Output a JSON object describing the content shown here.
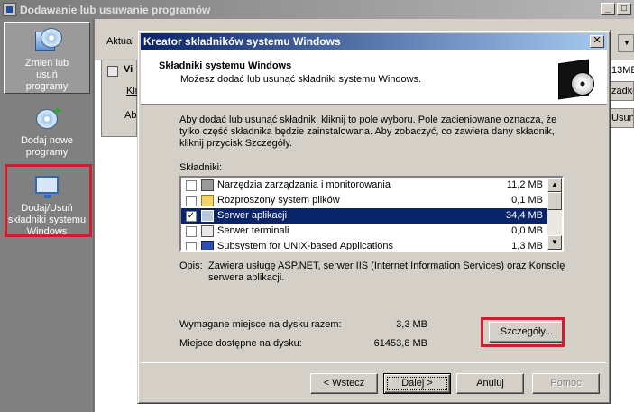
{
  "parent": {
    "title": "Dodawanie lub usuwanie programów",
    "sidebar": {
      "items": [
        {
          "label": "Zmień lub usuń programy",
          "icon": "cd-box-icon"
        },
        {
          "label": "Dodaj nowe programy",
          "icon": "cd-add-icon"
        },
        {
          "label": "Dodaj/Usuń składniki systemu Windows",
          "icon": "windows-components-icon"
        }
      ]
    },
    "main": {
      "sort_label": "Aktual",
      "item_title": "Vi",
      "item_link": "Kli",
      "item_sub": "Ab",
      "size": "13MB",
      "right_button_1": "zadko",
      "right_button_2": "Usuń"
    }
  },
  "dialog": {
    "title": "Kreator składników systemu Windows",
    "header_title": "Składniki systemu Windows",
    "header_subtitle": "Możesz dodać lub usunąć składniki systemu Windows.",
    "intro": "Aby dodać lub usunąć składnik, kliknij to pole wyboru. Pole zacieniowane oznacza, że tylko część składnika będzie zainstalowana. Aby zobaczyć, co zawiera dany składnik, kliknij przycisk Szczegóły.",
    "components_label": "Składniki:",
    "components": [
      {
        "name": "Narzędzia zarządzania i monitorowania",
        "size": "11,2 MB",
        "checked": false,
        "selected": false,
        "icon": "tools-icon"
      },
      {
        "name": "Rozproszony system plików",
        "size": "0,1 MB",
        "checked": false,
        "selected": false,
        "icon": "folder-icon"
      },
      {
        "name": "Serwer aplikacji",
        "size": "34,4 MB",
        "checked": true,
        "selected": true,
        "icon": "server-icon"
      },
      {
        "name": "Serwer terminali",
        "size": "0,0 MB",
        "checked": false,
        "selected": false,
        "icon": "terminal-icon"
      },
      {
        "name": "Subsystem for UNIX-based Applications",
        "size": "1,3 MB",
        "checked": false,
        "selected": false,
        "icon": "unix-icon"
      }
    ],
    "description_label": "Opis:",
    "description": "Zawiera usługę ASP.NET, serwer IIS (Internet Information Services) oraz Konsolę serwera aplikacji.",
    "disk_required_label": "Wymagane miejsce na dysku razem:",
    "disk_required_value": "3,3 MB",
    "disk_free_label": "Miejsce dostępne na dysku:",
    "disk_free_value": "61453,8 MB",
    "details_button": "Szczegóły...",
    "back_button": "< Wstecz",
    "next_button": "Dalej >",
    "cancel_button": "Anuluj",
    "help_button": "Pomoc"
  },
  "colors": {
    "highlight": "#cc1e2e",
    "title_active": "#0a246a",
    "selection": "#0a246a"
  }
}
